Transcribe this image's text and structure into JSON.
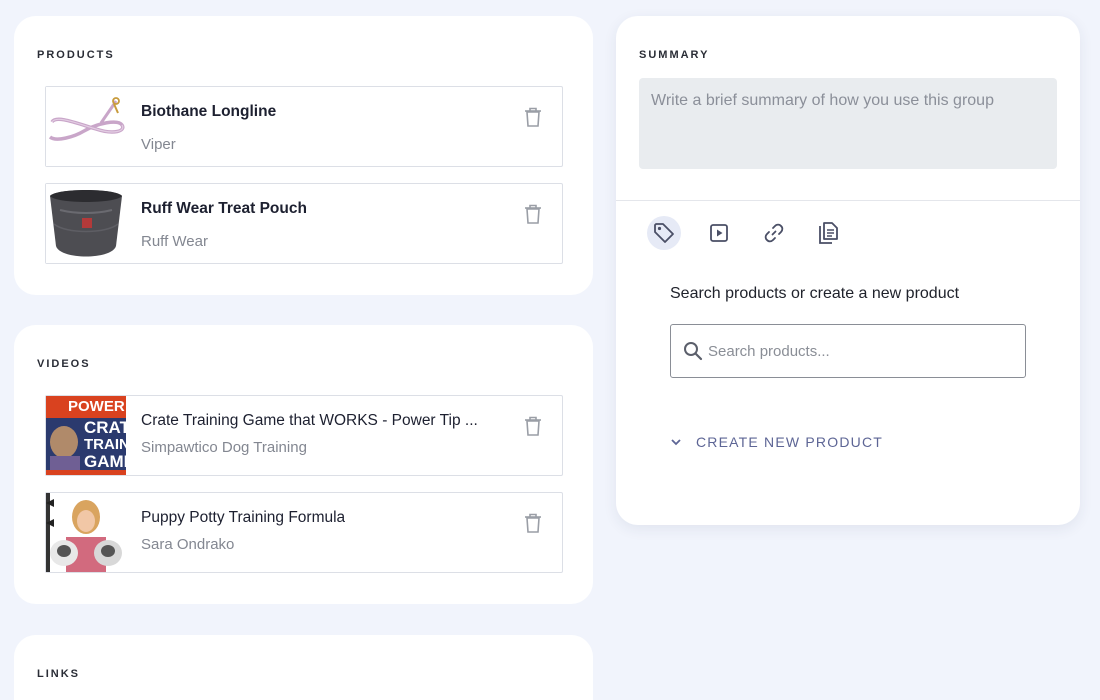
{
  "products": {
    "title": "PRODUCTS",
    "items": [
      {
        "name": "Biothane Longline",
        "brand": "Viper"
      },
      {
        "name": "Ruff Wear Treat Pouch",
        "brand": "Ruff Wear"
      }
    ]
  },
  "videos": {
    "title": "VIDEOS",
    "items": [
      {
        "name": "Crate Training Game that WORKS - Power Tip ...",
        "channel": "Simpawtico Dog Training",
        "thumb_text": [
          "POWER TIP",
          "CRATE",
          "TRAINI",
          "GAME"
        ]
      },
      {
        "name": "Puppy Potty Training Formula",
        "channel": "Sara Ondrako"
      }
    ]
  },
  "links": {
    "title": "LINKS"
  },
  "summary": {
    "title": "SUMMARY",
    "placeholder": "Write a brief summary of how you use this group",
    "tools": [
      "tag-icon",
      "video-icon",
      "link-icon",
      "document-icon"
    ],
    "search_label": "Search products or create a new product",
    "search_placeholder": "Search products...",
    "create_label": "CREATE NEW PRODUCT"
  },
  "colors": {
    "background": "#f1f4fc",
    "accent": "#5d6595",
    "active_tool": "#e6eaf6"
  }
}
